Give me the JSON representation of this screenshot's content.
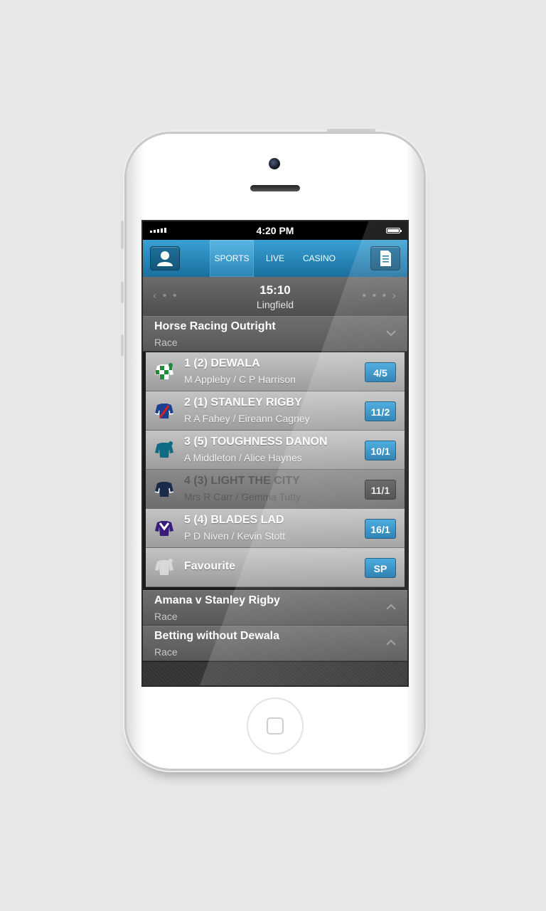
{
  "status_bar": {
    "time": "4:20 PM"
  },
  "nav": {
    "tabs": [
      {
        "label": "SPORTS",
        "active": true
      },
      {
        "label": "LIVE",
        "active": false
      },
      {
        "label": "CASINO",
        "active": false
      }
    ],
    "left_icon": "user-icon",
    "right_icon": "betslip-icon"
  },
  "race": {
    "time": "15:10",
    "venue": "Lingfield"
  },
  "market": {
    "title": "Horse Racing Outright",
    "subtitle": "Race",
    "expanded": true,
    "runners": [
      {
        "name": "1 (2) DEWALA",
        "jockey_trainer": "M Appleby / C P Harrison",
        "odds": "4/5",
        "silk_colors": [
          "#1e8a3a",
          "#ffffff"
        ],
        "enabled": true
      },
      {
        "name": "2 (1) STANLEY RIGBY",
        "jockey_trainer": "R A Fahey / Eireann Cagney",
        "odds": "11/2",
        "silk_colors": [
          "#1c3f8f",
          "#d0202a"
        ],
        "enabled": true
      },
      {
        "name": "3 (5) TOUGHNESS DANON",
        "jockey_trainer": "A Middleton / Alice Haynes",
        "odds": "10/1",
        "silk_colors": [
          "#0f6a84",
          "#0f6a84"
        ],
        "enabled": true
      },
      {
        "name": "4 (3) LIGHT THE CITY",
        "jockey_trainer": "Mrs R Carr / Gemma Tutty",
        "odds": "11/1",
        "silk_colors": [
          "#1a2a4a",
          "#ffffff"
        ],
        "enabled": false
      },
      {
        "name": "5 (4) BLADES LAD",
        "jockey_trainer": "P D Niven / Kevin Stott",
        "odds": "16/1",
        "silk_colors": [
          "#3a1a7a",
          "#ffffff"
        ],
        "enabled": true
      },
      {
        "name": "Favourite",
        "jockey_trainer": "",
        "odds": "SP",
        "silk_colors": [
          "#d8d8d8",
          "#d8d8d8"
        ],
        "enabled": true
      }
    ]
  },
  "other_markets": [
    {
      "title": "Amana v Stanley Rigby",
      "subtitle": "Race"
    },
    {
      "title": "Betting without Dewala",
      "subtitle": "Race"
    }
  ]
}
